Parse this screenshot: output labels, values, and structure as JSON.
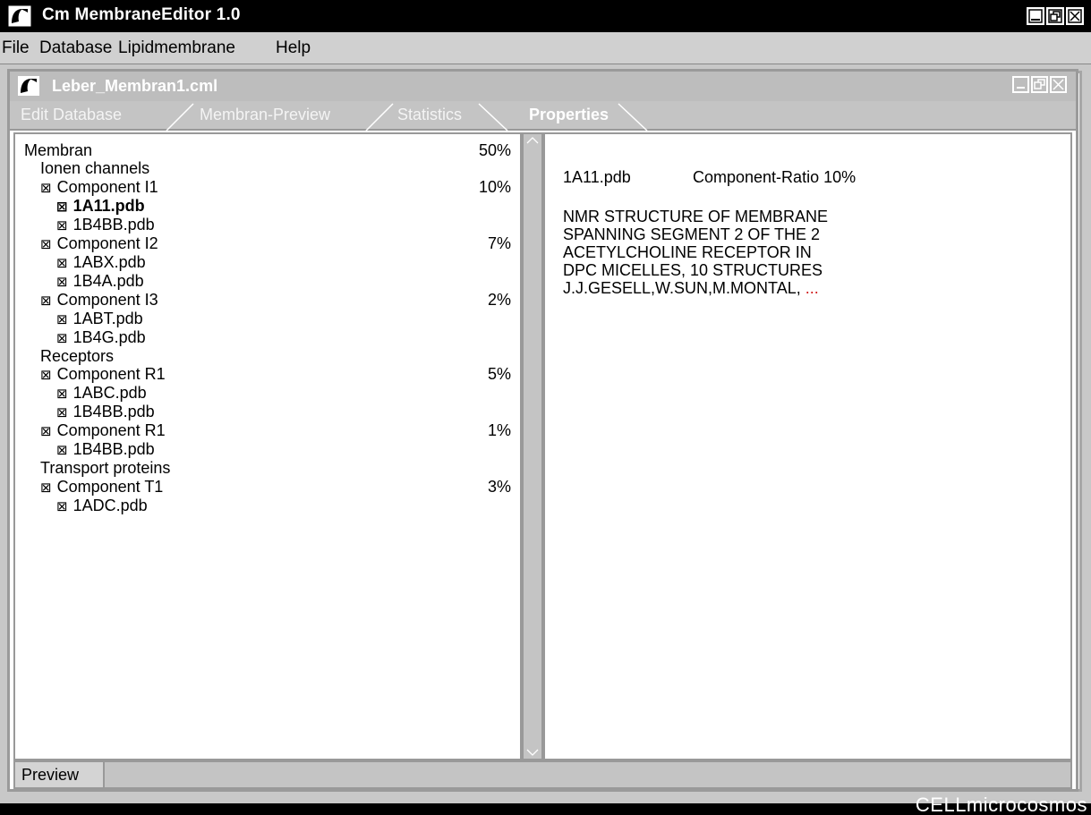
{
  "app": {
    "title": "Cm MembraneEditor 1.0",
    "watermark": "CELLmicrocosmos"
  },
  "menu": {
    "items": [
      "File",
      "Database",
      "Lipidmembrane",
      "Help"
    ]
  },
  "document": {
    "title": "Leber_Membran1.cml"
  },
  "tabs": [
    {
      "label": "Edit Database",
      "active": false
    },
    {
      "label": "Membran-Preview",
      "active": false
    },
    {
      "label": "Statistics",
      "active": false
    },
    {
      "label": "Properties",
      "active": true
    }
  ],
  "tree": {
    "root": {
      "label": "Membran",
      "percent": "50%"
    },
    "rows": [
      {
        "label": "Ionen channels",
        "checkbox": false,
        "level": 1,
        "percent": "",
        "bold": false
      },
      {
        "label": "Component I1",
        "checkbox": true,
        "level": 1,
        "percent": "10%",
        "bold": false
      },
      {
        "label": "1A11.pdb",
        "checkbox": true,
        "level": 2,
        "percent": "",
        "bold": true
      },
      {
        "label": "1B4BB.pdb",
        "checkbox": true,
        "level": 2,
        "percent": "",
        "bold": false
      },
      {
        "label": "Component I2",
        "checkbox": true,
        "level": 1,
        "percent": "7%",
        "bold": false
      },
      {
        "label": "1ABX.pdb",
        "checkbox": true,
        "level": 2,
        "percent": "",
        "bold": false
      },
      {
        "label": "1B4A.pdb",
        "checkbox": true,
        "level": 2,
        "percent": "",
        "bold": false
      },
      {
        "label": "Component I3",
        "checkbox": true,
        "level": 1,
        "percent": "2%",
        "bold": false
      },
      {
        "label": "1ABT.pdb",
        "checkbox": true,
        "level": 2,
        "percent": "",
        "bold": false
      },
      {
        "label": "1B4G.pdb",
        "checkbox": true,
        "level": 2,
        "percent": "",
        "bold": false
      },
      {
        "label": "Receptors",
        "checkbox": false,
        "level": 1,
        "percent": "",
        "bold": false
      },
      {
        "label": "Component R1",
        "checkbox": true,
        "level": 1,
        "percent": "5%",
        "bold": false
      },
      {
        "label": "1ABC.pdb",
        "checkbox": true,
        "level": 2,
        "percent": "",
        "bold": false
      },
      {
        "label": "1B4BB.pdb",
        "checkbox": true,
        "level": 2,
        "percent": "",
        "bold": false
      },
      {
        "label": "Component R1",
        "checkbox": true,
        "level": 1,
        "percent": "1%",
        "bold": false
      },
      {
        "label": "1B4BB.pdb",
        "checkbox": true,
        "level": 2,
        "percent": "",
        "bold": false
      },
      {
        "label": "Transport proteins",
        "checkbox": false,
        "level": 1,
        "percent": "",
        "bold": false
      },
      {
        "label": "Component T1",
        "checkbox": true,
        "level": 1,
        "percent": "3%",
        "bold": false
      },
      {
        "label": "1ADC.pdb",
        "checkbox": true,
        "level": 2,
        "percent": "",
        "bold": false
      }
    ]
  },
  "properties": {
    "file": "1A11.pdb",
    "ratio": "Component-Ratio 10%",
    "description": [
      "NMR STRUCTURE OF MEMBRANE",
      "SPANNING SEGMENT 2 OF THE 2",
      "ACETYLCHOLINE RECEPTOR IN",
      "DPC MICELLES, 10 STRUCTURES",
      "J.J.GESELL,W.SUN,M.MONTAL,"
    ],
    "ellipsis": "..."
  },
  "statusbar": {
    "preview_label": "Preview"
  },
  "icons": {
    "checkbox": "checked-box-icon",
    "app_logo": "app-logo-icon",
    "minimize": "minimize-icon",
    "restore": "restore-icon",
    "close": "close-icon",
    "scroll_up": "scroll-up-icon",
    "scroll_down": "scroll-down-icon"
  },
  "colors": {
    "titlebar": "#000000",
    "doc_titlebar": "#bdbdbd",
    "ellipsis": "#d01818"
  }
}
